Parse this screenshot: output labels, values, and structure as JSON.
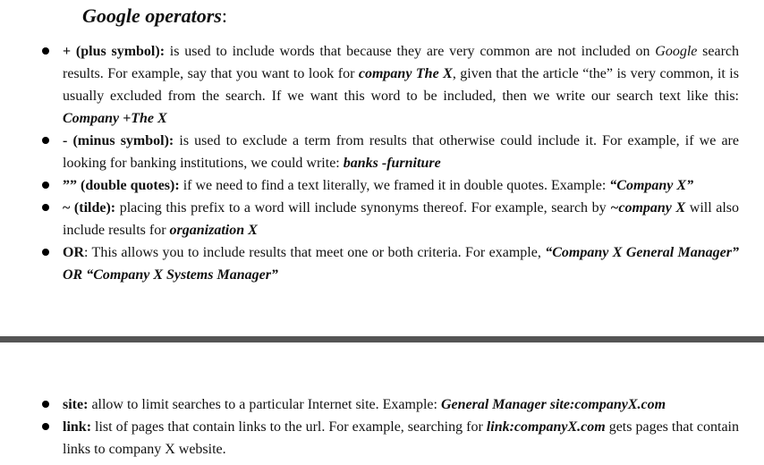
{
  "heading": {
    "em": "Google operators",
    "rest": ":"
  },
  "operators": [
    {
      "term": "+ (plus symbol):",
      "t1": " is used to include words that because they are very common are not included on ",
      "google": "Google",
      "t2": " search results. For example, say that you want to look for ",
      "ex1": "company The X",
      "t3": ", given that the article “the” is very common, it is usually excluded from the search. If we want this word to be included, then we write our search text like this: ",
      "ex2": "Company +The X"
    },
    {
      "term": " - (minus symbol):",
      "t1": " is used to exclude a term from results that otherwise could include it. For example, if we are looking for banking institutions, we could write: ",
      "ex1": "banks -furniture"
    },
    {
      "term": "”” (double quotes):",
      "t1": " if we need to find a text literally, we framed it in double quotes. Example: ",
      "ex1": "“Company X”"
    },
    {
      "term": "~ (tilde):",
      "t1": " placing this prefix to a word will include synonyms thereof. For example, search by  ",
      "ex1": "~company X",
      "t2": " will also include results for  ",
      "ex2": "organization X"
    },
    {
      "term": "OR",
      "t1": ": This allows you to include results that meet one or both criteria. For example, ",
      "ex1": "“Company X General Manager” OR “Company X Systems Manager”"
    },
    {
      "term": "site:",
      "t1": " allow to limit searches to a particular Internet site. Example: ",
      "ex1": "General Manager site:companyX.com"
    },
    {
      "term": "link:",
      "t1": " list of pages that contain links to the url. For example, searching for ",
      "ex1": "link:companyX.com",
      "t2": " gets pages that contain links to company X website."
    }
  ]
}
